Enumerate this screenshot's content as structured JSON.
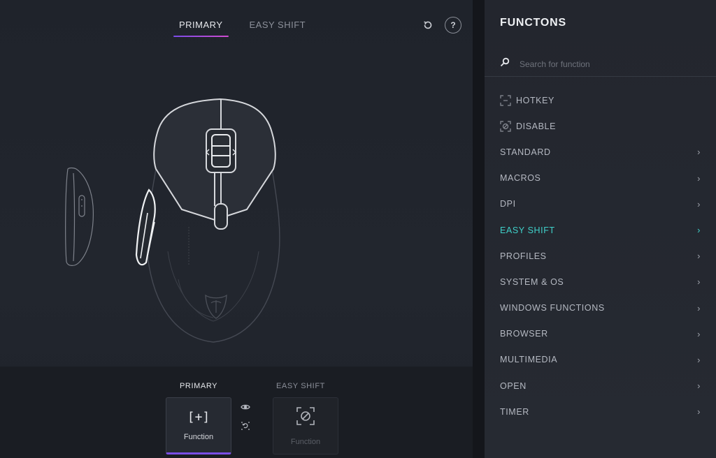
{
  "header": {
    "tabs": [
      {
        "label": "PRIMARY",
        "active": true
      },
      {
        "label": "EASY SHIFT",
        "active": false
      }
    ],
    "reset_icon": "reset-icon",
    "help_label": "?"
  },
  "bottom": {
    "primary_label": "PRIMARY",
    "easy_label": "EASY SHIFT",
    "primary_slot": {
      "glyph": "[+]",
      "text": "Function"
    },
    "easy_slot": {
      "glyph": "⊘",
      "text": "Function"
    }
  },
  "sidebar": {
    "title": "FUNCTONS",
    "search_placeholder": "Search for function",
    "items": [
      {
        "label": "HOTKEY",
        "icon": "hotkey-icon",
        "has_chevron": false
      },
      {
        "label": "DISABLE",
        "icon": "disable-icon",
        "has_chevron": false
      },
      {
        "label": "STANDARD",
        "has_chevron": true
      },
      {
        "label": "MACROS",
        "has_chevron": true
      },
      {
        "label": "DPI",
        "has_chevron": true
      },
      {
        "label": "EASY SHIFT",
        "has_chevron": true,
        "active": true
      },
      {
        "label": "PROFILES",
        "has_chevron": true
      },
      {
        "label": "SYSTEM & OS",
        "has_chevron": true
      },
      {
        "label": "WINDOWS FUNCTIONS",
        "has_chevron": true
      },
      {
        "label": "BROWSER",
        "has_chevron": true
      },
      {
        "label": "MULTIMEDIA",
        "has_chevron": true
      },
      {
        "label": "OPEN",
        "has_chevron": true
      },
      {
        "label": "TIMER",
        "has_chevron": true
      }
    ]
  },
  "colors": {
    "accent_purple": "#7a4ee6",
    "accent_teal": "#3fd0c9"
  }
}
